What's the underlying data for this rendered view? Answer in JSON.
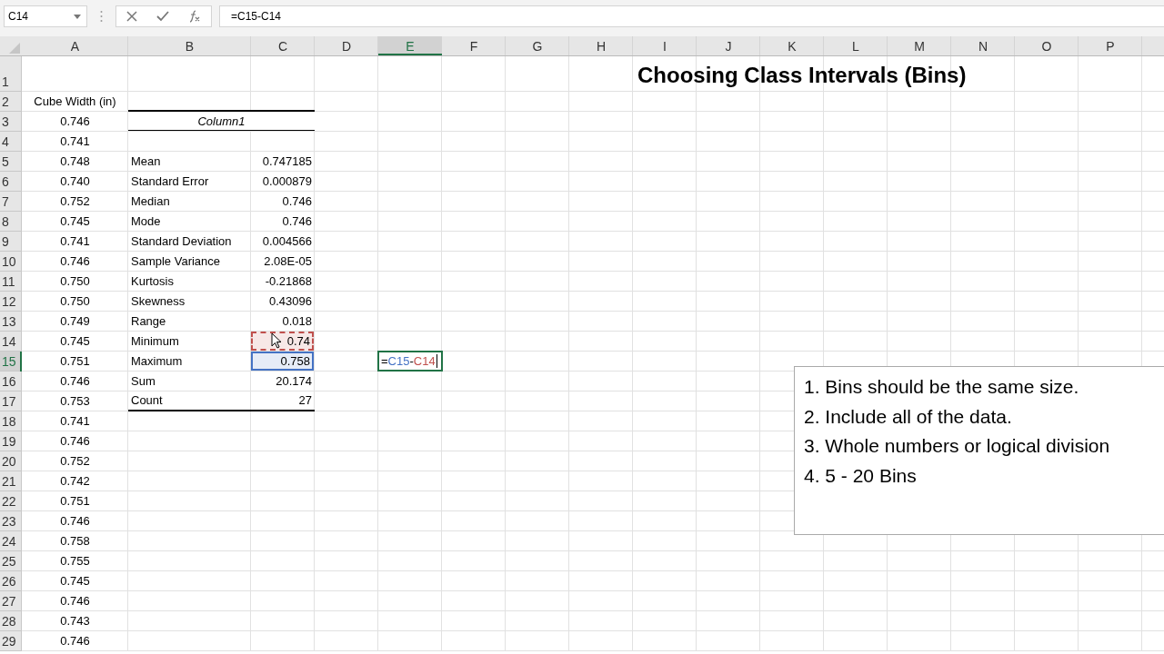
{
  "name_box": "C14",
  "formula": "=C15-C14",
  "columns": [
    {
      "label": "A",
      "selected": false
    },
    {
      "label": "B",
      "selected": false
    },
    {
      "label": "C",
      "selected": false
    },
    {
      "label": "D",
      "selected": false
    },
    {
      "label": "E",
      "selected": true
    },
    {
      "label": "F",
      "selected": false
    },
    {
      "label": "G",
      "selected": false
    },
    {
      "label": "H",
      "selected": false
    },
    {
      "label": "I",
      "selected": false
    },
    {
      "label": "J",
      "selected": false
    },
    {
      "label": "K",
      "selected": false
    },
    {
      "label": "L",
      "selected": false
    },
    {
      "label": "M",
      "selected": false
    },
    {
      "label": "N",
      "selected": false
    },
    {
      "label": "O",
      "selected": false
    },
    {
      "label": "P",
      "selected": false
    }
  ],
  "rows": [
    {
      "number": "1",
      "selected": false,
      "kind": "title",
      "cells": {
        "I": {
          "kind": "title",
          "text": "Choosing Class Intervals (Bins)"
        }
      }
    },
    {
      "number": "2",
      "selected": false,
      "kind": "plain",
      "cells": {
        "A": {
          "kind": "center",
          "text": "Cube Width (in)"
        }
      }
    },
    {
      "number": "3",
      "selected": false,
      "kind": "plain",
      "cells": {
        "A": {
          "kind": "center",
          "text": "0.746"
        },
        "B": {
          "kind": "header",
          "text": "Column1"
        }
      }
    },
    {
      "number": "4",
      "selected": false,
      "kind": "plain",
      "cells": {
        "A": {
          "kind": "center",
          "text": "0.741"
        }
      }
    },
    {
      "number": "5",
      "selected": false,
      "kind": "plain",
      "cells": {
        "A": {
          "kind": "center",
          "text": "0.748"
        },
        "B": {
          "kind": "left",
          "text": "Mean"
        },
        "C": {
          "kind": "right",
          "text": "0.747185"
        }
      }
    },
    {
      "number": "6",
      "selected": false,
      "kind": "plain",
      "cells": {
        "A": {
          "kind": "center",
          "text": "0.740"
        },
        "B": {
          "kind": "left",
          "text": "Standard Error"
        },
        "C": {
          "kind": "right",
          "text": "0.000879"
        }
      }
    },
    {
      "number": "7",
      "selected": false,
      "kind": "plain",
      "cells": {
        "A": {
          "kind": "center",
          "text": "0.752"
        },
        "B": {
          "kind": "left",
          "text": "Median"
        },
        "C": {
          "kind": "right",
          "text": "0.746"
        }
      }
    },
    {
      "number": "8",
      "selected": false,
      "kind": "plain",
      "cells": {
        "A": {
          "kind": "center",
          "text": "0.745"
        },
        "B": {
          "kind": "left",
          "text": "Mode"
        },
        "C": {
          "kind": "right",
          "text": "0.746"
        }
      }
    },
    {
      "number": "9",
      "selected": false,
      "kind": "plain",
      "cells": {
        "A": {
          "kind": "center",
          "text": "0.741"
        },
        "B": {
          "kind": "left",
          "text": "Standard Deviation"
        },
        "C": {
          "kind": "right",
          "text": "0.004566"
        }
      }
    },
    {
      "number": "10",
      "selected": false,
      "kind": "plain",
      "cells": {
        "A": {
          "kind": "center",
          "text": "0.746"
        },
        "B": {
          "kind": "left",
          "text": "Sample Variance"
        },
        "C": {
          "kind": "right",
          "text": "2.08E-05"
        }
      }
    },
    {
      "number": "11",
      "selected": false,
      "kind": "plain",
      "cells": {
        "A": {
          "kind": "center",
          "text": "0.750"
        },
        "B": {
          "kind": "left",
          "text": "Kurtosis"
        },
        "C": {
          "kind": "right",
          "text": "-0.21868"
        }
      }
    },
    {
      "number": "12",
      "selected": false,
      "kind": "plain",
      "cells": {
        "A": {
          "kind": "center",
          "text": "0.750"
        },
        "B": {
          "kind": "left",
          "text": "Skewness"
        },
        "C": {
          "kind": "right",
          "text": "0.43096"
        }
      }
    },
    {
      "number": "13",
      "selected": false,
      "kind": "plain",
      "cells": {
        "A": {
          "kind": "center",
          "text": "0.749"
        },
        "B": {
          "kind": "left",
          "text": "Range"
        },
        "C": {
          "kind": "right",
          "text": "0.018"
        }
      }
    },
    {
      "number": "14",
      "selected": false,
      "kind": "plain",
      "cells": {
        "A": {
          "kind": "center",
          "text": "0.745"
        },
        "B": {
          "kind": "left",
          "text": "Minimum"
        },
        "C": {
          "kind": "copied",
          "text": "0.74",
          "color": "#c0504d"
        }
      }
    },
    {
      "number": "15",
      "selected": true,
      "kind": "plain",
      "cells": {
        "A": {
          "kind": "center",
          "text": "0.751"
        },
        "B": {
          "kind": "left",
          "text": "Maximum"
        },
        "C": {
          "kind": "referenced",
          "text": "0.758",
          "color": "#4472c4"
        },
        "E": {
          "kind": "editing",
          "parts": [
            {
              "text": "="
            },
            {
              "text": "C15",
              "color": "#4472c4"
            },
            {
              "text": "-"
            },
            {
              "text": "C14",
              "color": "#c0504d"
            }
          ]
        }
      }
    },
    {
      "number": "16",
      "selected": false,
      "kind": "plain",
      "cells": {
        "A": {
          "kind": "center",
          "text": "0.746"
        },
        "B": {
          "kind": "left",
          "text": "Sum"
        },
        "C": {
          "kind": "right",
          "text": "20.174"
        }
      }
    },
    {
      "number": "17",
      "selected": false,
      "kind": "table-end",
      "cells": {
        "A": {
          "kind": "center",
          "text": "0.753"
        },
        "B": {
          "kind": "left",
          "text": "Count"
        },
        "C": {
          "kind": "right",
          "text": "27"
        }
      }
    },
    {
      "number": "18",
      "selected": false,
      "kind": "plain",
      "cells": {
        "A": {
          "kind": "center",
          "text": "0.741"
        }
      }
    },
    {
      "number": "19",
      "selected": false,
      "kind": "plain",
      "cells": {
        "A": {
          "kind": "center",
          "text": "0.746"
        }
      }
    },
    {
      "number": "20",
      "selected": false,
      "kind": "plain",
      "cells": {
        "A": {
          "kind": "center",
          "text": "0.752"
        }
      }
    },
    {
      "number": "21",
      "selected": false,
      "kind": "plain",
      "cells": {
        "A": {
          "kind": "center",
          "text": "0.742"
        }
      }
    },
    {
      "number": "22",
      "selected": false,
      "kind": "plain",
      "cells": {
        "A": {
          "kind": "center",
          "text": "0.751"
        }
      }
    },
    {
      "number": "23",
      "selected": false,
      "kind": "plain",
      "cells": {
        "A": {
          "kind": "center",
          "text": "0.746"
        }
      }
    },
    {
      "number": "24",
      "selected": false,
      "kind": "plain",
      "cells": {
        "A": {
          "kind": "center",
          "text": "0.758"
        }
      }
    },
    {
      "number": "25",
      "selected": false,
      "kind": "plain",
      "cells": {
        "A": {
          "kind": "center",
          "text": "0.755"
        }
      }
    },
    {
      "number": "26",
      "selected": false,
      "kind": "plain",
      "cells": {
        "A": {
          "kind": "center",
          "text": "0.745"
        }
      }
    },
    {
      "number": "27",
      "selected": false,
      "kind": "plain",
      "cells": {
        "A": {
          "kind": "center",
          "text": "0.746"
        }
      }
    },
    {
      "number": "28",
      "selected": false,
      "kind": "plain",
      "cells": {
        "A": {
          "kind": "center",
          "text": "0.743"
        }
      }
    },
    {
      "number": "29",
      "selected": false,
      "kind": "plain",
      "cells": {
        "A": {
          "kind": "center",
          "text": "0.746"
        }
      }
    }
  ],
  "text_box": [
    "1. Bins should be the same size.",
    "2. Include all of the data.",
    "3. Whole numbers or logical division",
    "4. 5 - 20 Bins"
  ]
}
